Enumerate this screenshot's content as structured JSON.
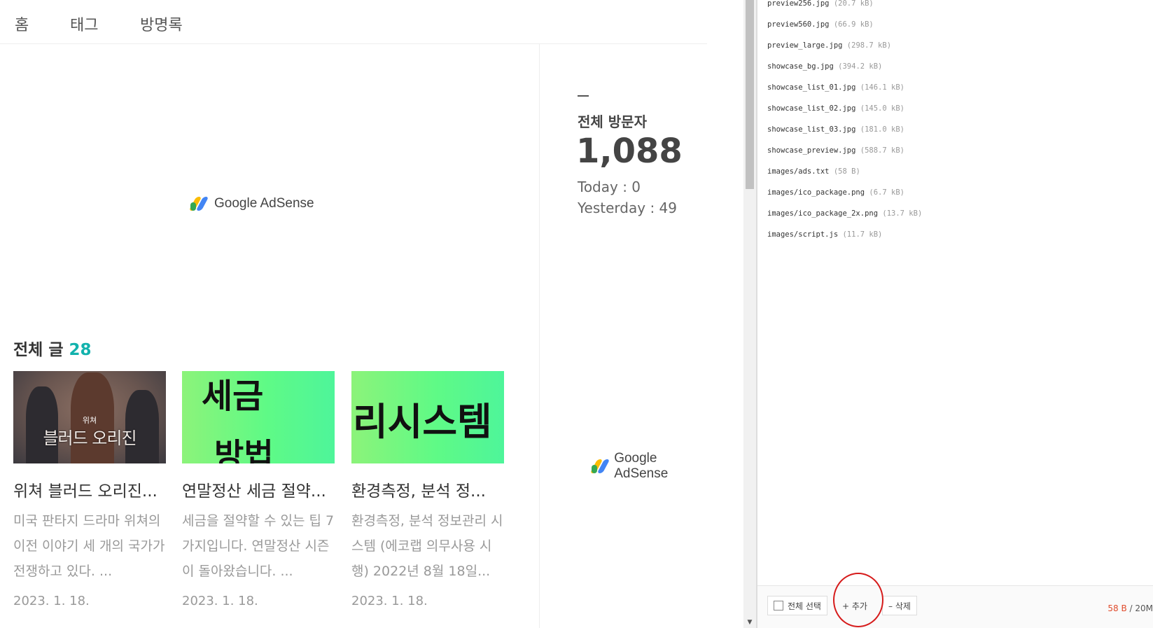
{
  "nav": {
    "items": [
      "홈",
      "태그",
      "방명록"
    ]
  },
  "adsense": {
    "label": "Google AdSense"
  },
  "posts": {
    "heading": "전체 글",
    "count": "28",
    "cards": [
      {
        "thumb_text": [
          "위쳐",
          "블러드 오리진"
        ],
        "title": "위쳐 블러드 오리진...",
        "summary": "미국 판타지 드라마 위쳐의 이전 이야기 세 개의 국가가 전쟁하고 있다. ...",
        "date": "2023. 1. 18."
      },
      {
        "thumb_text": [
          "세금",
          "방법"
        ],
        "title": "연말정산 세금 절약...",
        "summary": "세금을 절약할 수 있는 팁 7가지입니다. 연말정산 시즌이 돌아왔습니다. ...",
        "date": "2023. 1. 18."
      },
      {
        "thumb_text": [
          "리시스템"
        ],
        "title": "환경측정, 분석 정...",
        "summary": "환경측정, 분석 정보관리 시스템 (에코랩 의무사용 시행) 2022년 8월 18일...",
        "date": "2023. 1. 18."
      }
    ]
  },
  "visitors": {
    "label": "전체 방문자",
    "total": "1,088",
    "today": "Today : 0",
    "yesterday": "Yesterday : 49"
  },
  "files": [
    {
      "name": "preview256.jpg",
      "size": "(20.7 kB)"
    },
    {
      "name": "preview560.jpg",
      "size": "(66.9 kB)"
    },
    {
      "name": "preview_large.jpg",
      "size": "(298.7 kB)"
    },
    {
      "name": "showcase_bg.jpg",
      "size": "(394.2 kB)"
    },
    {
      "name": "showcase_list_01.jpg",
      "size": "(146.1 kB)"
    },
    {
      "name": "showcase_list_02.jpg",
      "size": "(145.0 kB)"
    },
    {
      "name": "showcase_list_03.jpg",
      "size": "(181.0 kB)"
    },
    {
      "name": "showcase_preview.jpg",
      "size": "(588.7 kB)"
    },
    {
      "name": "images/ads.txt",
      "size": "(58 B)"
    },
    {
      "name": "images/ico_package.png",
      "size": "(6.7 kB)"
    },
    {
      "name": "images/ico_package_2x.png",
      "size": "(13.7 kB)"
    },
    {
      "name": "images/script.js",
      "size": "(11.7 kB)"
    }
  ],
  "toolbar": {
    "select_all": "전체 선택",
    "add": "+ 추가",
    "delete": "– 삭제",
    "size_used": "58 B",
    "size_sep": " / 20M"
  },
  "colors": {
    "accent": "#12b2ad",
    "highlight": "#d61b1b",
    "used_size": "#e04b2c"
  },
  "icons": {
    "adsense": "google-adsense-logo-icon",
    "checkbox": "checkbox-icon",
    "scroll_down": "scroll-down-arrow-icon"
  }
}
